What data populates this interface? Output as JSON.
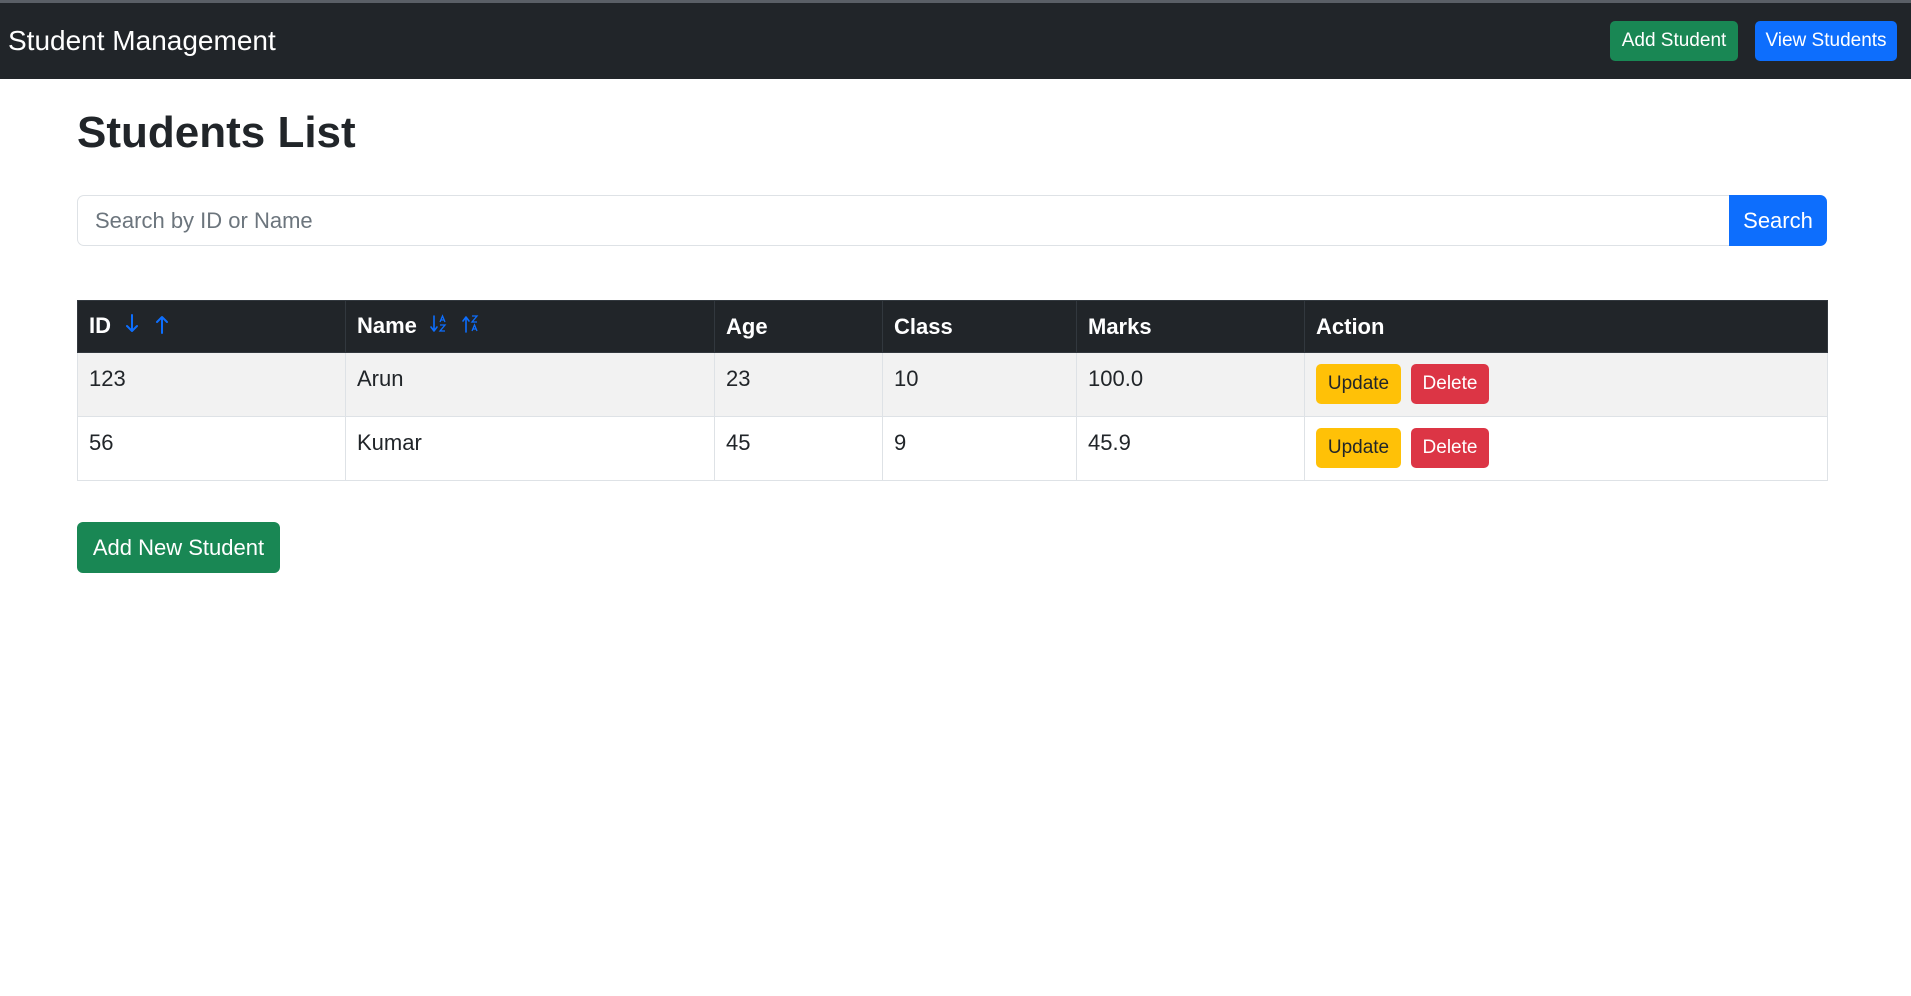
{
  "navbar": {
    "brand": "Student Management",
    "add_student_label": "Add Student",
    "view_students_label": "View Students"
  },
  "page": {
    "title": "Students List"
  },
  "search": {
    "placeholder": "Search by ID or Name",
    "value": "",
    "button_label": "Search"
  },
  "table": {
    "headers": {
      "id": "ID",
      "name": "Name",
      "age": "Age",
      "class": "Class",
      "marks": "Marks",
      "action": "Action"
    },
    "sort_icons": {
      "id_desc": "arrow-down-icon",
      "id_asc": "arrow-up-icon",
      "name_asc": "sort-alpha-down-icon",
      "name_desc": "sort-alpha-up-icon"
    },
    "rows": [
      {
        "id": "123",
        "name": "Arun",
        "age": "23",
        "class": "10",
        "marks": "100.0",
        "update_label": "Update",
        "delete_label": "Delete"
      },
      {
        "id": "56",
        "name": "Kumar",
        "age": "45",
        "class": "9",
        "marks": "45.9",
        "update_label": "Update",
        "delete_label": "Delete"
      }
    ]
  },
  "footer_actions": {
    "add_new_label": "Add New Student"
  },
  "colors": {
    "navbar_bg": "#212529",
    "primary": "#0d6efd",
    "success": "#198754",
    "warning": "#ffc107",
    "danger": "#dc3545",
    "sort_icon": "#0d6efd"
  }
}
